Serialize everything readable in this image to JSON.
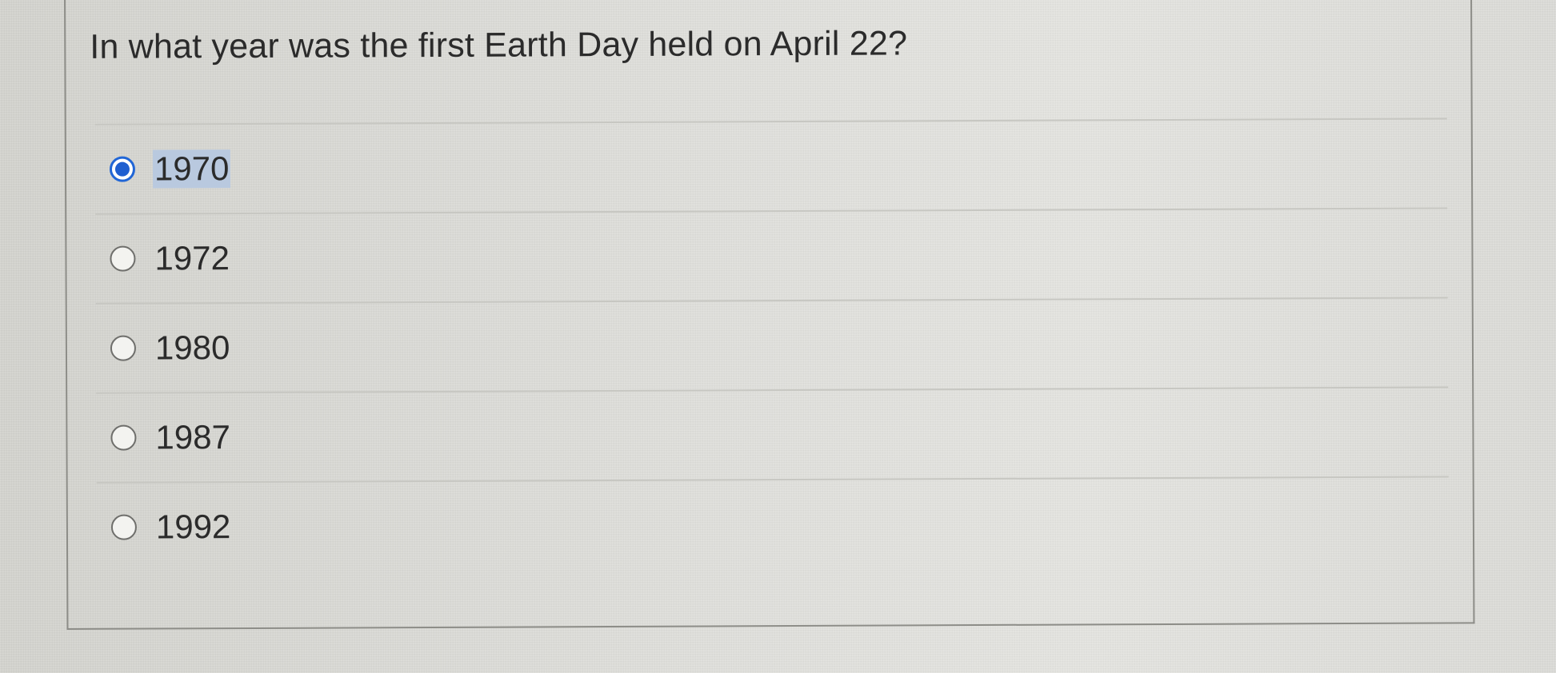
{
  "question": {
    "text": "In what year was the first Earth Day held on April 22?"
  },
  "options": [
    {
      "label": "1970",
      "selected": true
    },
    {
      "label": "1972",
      "selected": false
    },
    {
      "label": "1980",
      "selected": false
    },
    {
      "label": "1987",
      "selected": false
    },
    {
      "label": "1992",
      "selected": false
    }
  ],
  "colors": {
    "radio_selected": "#1f5fd0",
    "selection_highlight": "#b9c9df",
    "text": "#2b2b2b"
  },
  "icons": {
    "selected": "radio-selected-icon",
    "unselected": "radio-unselected-icon"
  }
}
